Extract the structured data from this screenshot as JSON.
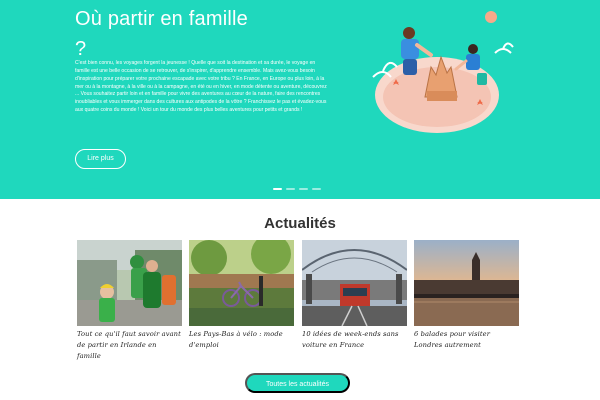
{
  "hero": {
    "title": "Où partir en famille ?",
    "text": "C'est bien connu, les voyages forgent la jeunesse ! Quelle que soit la destination et sa durée, le voyage en famille est une belle occasion de se retrouver, de s'inspirer, d'apprendre ensemble. Mais avez-vous besoin d'inspiration pour préparer votre prochaine escapade avec votre tribu ? En France, en Europe ou plus loin, à la mer ou à la montagne, à la ville ou à la campagne, en été ou en hiver, en mode détente ou aventure, découvrez ... Vous souhaitez partir loin et en famille pour vivre des aventures au cœur de la nature, faire des rencontres inoubliables et vous immerger dans des cultures aux antipodes de la vôtre ? Franchissez le pas et évadez-vous aux quatre coins du monde ! Voici un tour du monde des plus belles aventures pour petits et grands !",
    "read_more_label": "Lire plus",
    "slides": 4,
    "active_slide": 1,
    "illustration_icon": "family-sandcastle-illustration",
    "colors": {
      "background": "#1fd8bd",
      "text": "#ffffff"
    }
  },
  "news": {
    "heading": "Actualités",
    "articles": [
      {
        "title": "Tout ce qu'il faut savoir avant de partir en Irlande en famille",
        "image": "st-patricks-parade-photo"
      },
      {
        "title": "Les Pays-Bas à vélo : mode d'emploi",
        "image": "amsterdam-canal-bike-photo"
      },
      {
        "title": "10 idées de week-ends sans voiture en France",
        "image": "train-station-photo"
      },
      {
        "title": "6 balades pour visiter Londres autrement",
        "image": "london-westminster-sunset-photo"
      }
    ],
    "all_news_label": "Toutes les actualités"
  },
  "colors": {
    "accent": "#1fd8bd",
    "heading": "#333333",
    "body_text": "#222222"
  }
}
